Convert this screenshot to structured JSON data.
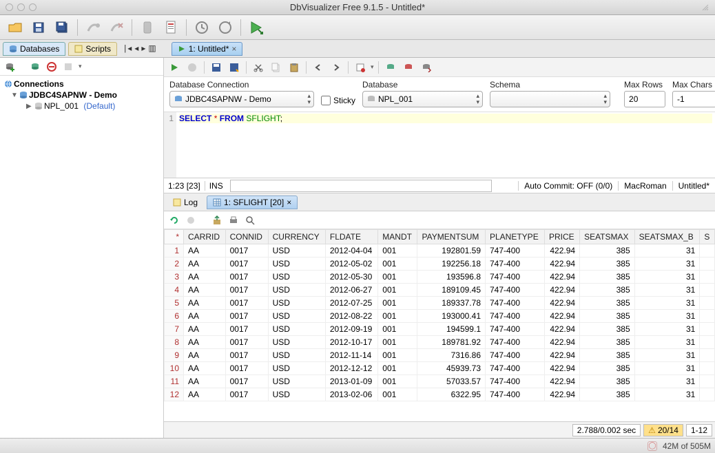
{
  "window": {
    "title": "DbVisualizer Free 9.1.5 - Untitled*"
  },
  "primary_tabs": {
    "databases": "Databases",
    "scripts": "Scripts",
    "editor": "1: Untitled*"
  },
  "tree": {
    "root": "Connections",
    "conn": "JDBC4SAPNW - Demo",
    "db": "NPL_001",
    "default": "(Default)"
  },
  "conn_row": {
    "db_connection_label": "Database Connection",
    "db_connection_value": "JDBC4SAPNW - Demo",
    "sticky_label": "Sticky",
    "database_label": "Database",
    "database_value": "NPL_001",
    "schema_label": "Schema",
    "schema_value": "",
    "max_rows_label": "Max Rows",
    "max_rows_value": "20",
    "max_chars_label": "Max Chars",
    "max_chars_value": "-1"
  },
  "sql": {
    "line1_kw1": "SELECT",
    "line1_star": "*",
    "line1_kw2": "FROM",
    "line1_id": "SFLIGHT",
    "line1_end": ";"
  },
  "status": {
    "pos": "1:23 [23]",
    "ins": "INS",
    "autocommit": "Auto Commit: OFF (0/0)",
    "encoding": "MacRoman",
    "doc": "Untitled*"
  },
  "results_tabs": {
    "log": "Log",
    "result": "1: SFLIGHT [20]"
  },
  "grid": {
    "cornerheader": "*",
    "columns": [
      "CARRID",
      "CONNID",
      "CURRENCY",
      "FLDATE",
      "MANDT",
      "PAYMENTSUM",
      "PLANETYPE",
      "PRICE",
      "SEATSMAX",
      "SEATSMAX_B",
      "S"
    ],
    "numeric_cols": [
      5,
      7,
      8,
      9
    ],
    "rows": [
      [
        "AA",
        "0017",
        "USD",
        "2012-04-04",
        "001",
        "192801.59",
        "747-400",
        "422.94",
        "385",
        "31",
        ""
      ],
      [
        "AA",
        "0017",
        "USD",
        "2012-05-02",
        "001",
        "192256.18",
        "747-400",
        "422.94",
        "385",
        "31",
        ""
      ],
      [
        "AA",
        "0017",
        "USD",
        "2012-05-30",
        "001",
        "193596.8",
        "747-400",
        "422.94",
        "385",
        "31",
        ""
      ],
      [
        "AA",
        "0017",
        "USD",
        "2012-06-27",
        "001",
        "189109.45",
        "747-400",
        "422.94",
        "385",
        "31",
        ""
      ],
      [
        "AA",
        "0017",
        "USD",
        "2012-07-25",
        "001",
        "189337.78",
        "747-400",
        "422.94",
        "385",
        "31",
        ""
      ],
      [
        "AA",
        "0017",
        "USD",
        "2012-08-22",
        "001",
        "193000.41",
        "747-400",
        "422.94",
        "385",
        "31",
        ""
      ],
      [
        "AA",
        "0017",
        "USD",
        "2012-09-19",
        "001",
        "194599.1",
        "747-400",
        "422.94",
        "385",
        "31",
        ""
      ],
      [
        "AA",
        "0017",
        "USD",
        "2012-10-17",
        "001",
        "189781.92",
        "747-400",
        "422.94",
        "385",
        "31",
        ""
      ],
      [
        "AA",
        "0017",
        "USD",
        "2012-11-14",
        "001",
        "7316.86",
        "747-400",
        "422.94",
        "385",
        "31",
        ""
      ],
      [
        "AA",
        "0017",
        "USD",
        "2012-12-12",
        "001",
        "45939.73",
        "747-400",
        "422.94",
        "385",
        "31",
        ""
      ],
      [
        "AA",
        "0017",
        "USD",
        "2013-01-09",
        "001",
        "57033.57",
        "747-400",
        "422.94",
        "385",
        "31",
        ""
      ],
      [
        "AA",
        "0017",
        "USD",
        "2013-02-06",
        "001",
        "6322.95",
        "747-400",
        "422.94",
        "385",
        "31",
        ""
      ]
    ]
  },
  "bottom": {
    "time": "2.788/0.002 sec",
    "warn": "20/14",
    "range": "1-12"
  },
  "app": {
    "mem": "42M of 505M"
  }
}
